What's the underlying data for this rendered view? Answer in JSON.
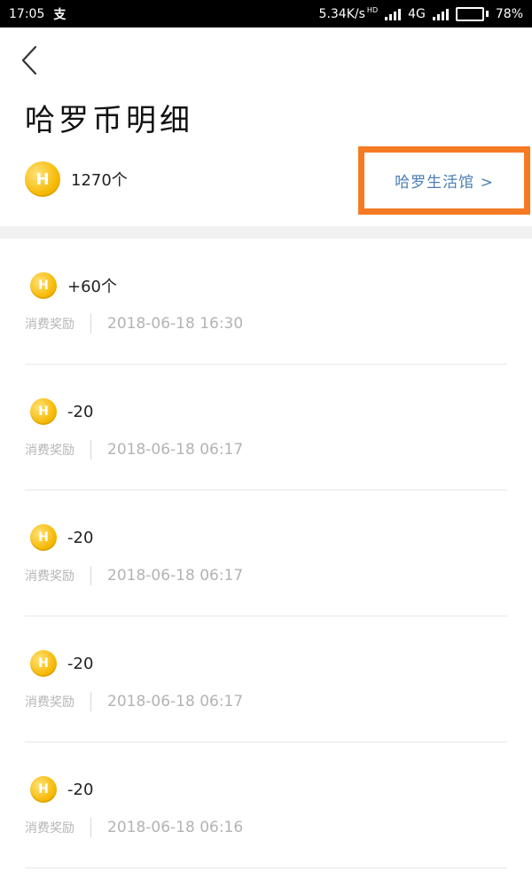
{
  "status_bar": {
    "time": "17:05",
    "app_glyph": "支",
    "net_speed": "5.34K/s",
    "hd_label": "HD",
    "network": "4G",
    "battery": "78%",
    "battery_fraction": 0.78,
    "battery_color": "#2ecc71"
  },
  "header": {
    "back_icon": "chevron-left-icon",
    "title": "哈罗币明细"
  },
  "balance": {
    "coin_letter": "H",
    "value": "1270个",
    "store_link": "哈罗生活馆 >",
    "highlight_color": "#f57a24"
  },
  "transactions": [
    {
      "amount": "+60个",
      "type": "消费奖励",
      "time": "2018-06-18 16:30"
    },
    {
      "amount": "-20",
      "type": "消费奖励",
      "time": "2018-06-18 06:17"
    },
    {
      "amount": "-20",
      "type": "消费奖励",
      "time": "2018-06-18 06:17"
    },
    {
      "amount": "-20",
      "type": "消费奖励",
      "time": "2018-06-18 06:17"
    },
    {
      "amount": "-20",
      "type": "消费奖励",
      "time": "2018-06-18 06:16"
    }
  ]
}
